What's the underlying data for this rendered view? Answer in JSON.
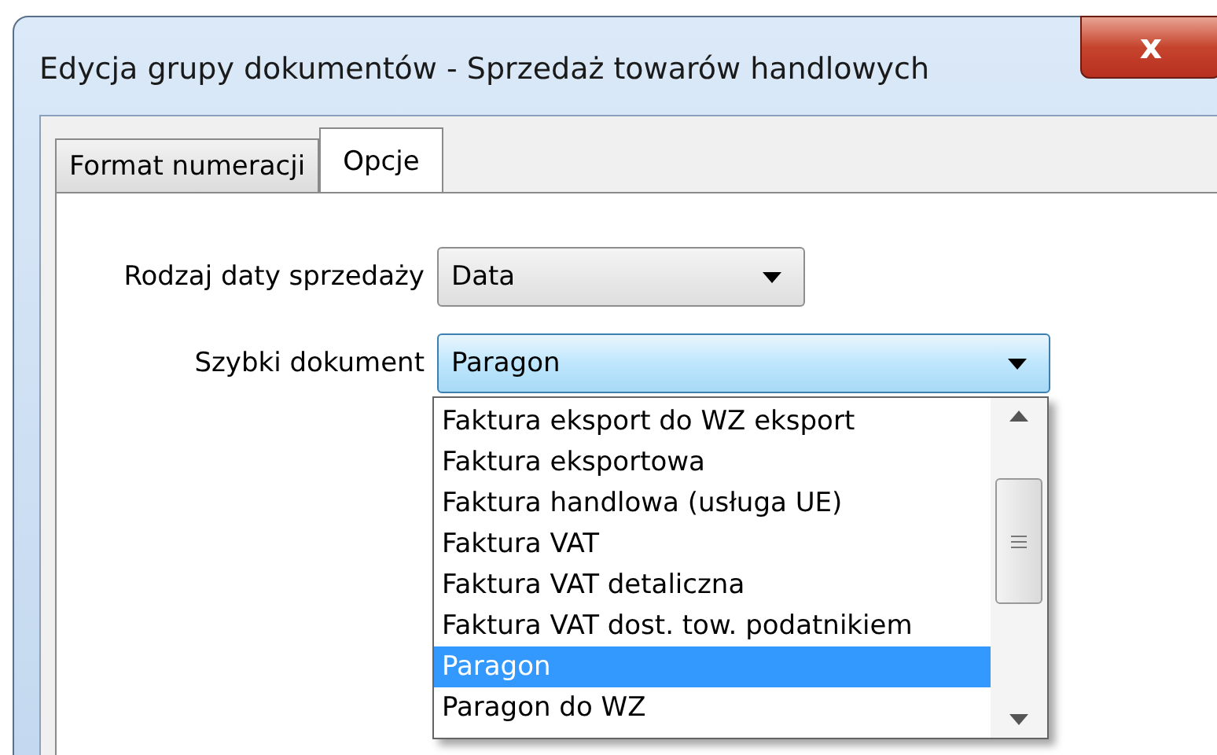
{
  "window": {
    "title": "Edycja grupy dokumentów - Sprzedaż towarów handlowych",
    "close_label": "x"
  },
  "tabs": [
    {
      "label": "Format numeracji",
      "selected": false
    },
    {
      "label": "Opcje",
      "selected": true
    }
  ],
  "fields": [
    {
      "label": "Rodzaj daty sprzedaży",
      "value": "Data",
      "focused": false
    },
    {
      "label": "Szybki dokument",
      "value": "Paragon",
      "focused": true,
      "options": [
        {
          "label": "Faktura eksport do WZ eksport",
          "selected": false
        },
        {
          "label": "Faktura eksportowa",
          "selected": false
        },
        {
          "label": "Faktura handlowa (usługa UE)",
          "selected": false
        },
        {
          "label": "Faktura VAT",
          "selected": false
        },
        {
          "label": "Faktura VAT detaliczna",
          "selected": false
        },
        {
          "label": "Faktura VAT dost. tow. podatnikiem",
          "selected": false
        },
        {
          "label": "Paragon",
          "selected": true
        },
        {
          "label": "Paragon do WZ",
          "selected": false
        }
      ]
    }
  ]
}
